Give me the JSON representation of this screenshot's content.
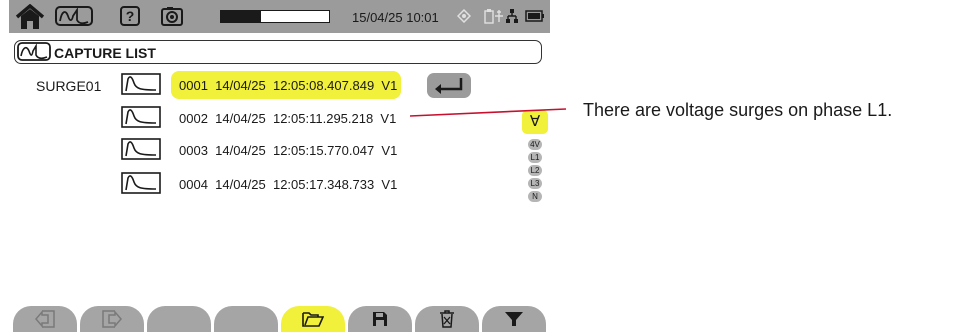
{
  "top_bar": {
    "icons": [
      "home-icon",
      "waveform-mode-icon",
      "help-icon",
      "camera-icon",
      "target-icon",
      "usb-icon",
      "network-icon",
      "battery-icon"
    ],
    "help_label": "?",
    "storage_used_fraction": 0.37,
    "datetime": "15/04/25 10:01"
  },
  "title_bar": {
    "title": "CAPTURE LIST",
    "icon": "waveform-mode-icon"
  },
  "capture_group": {
    "label": "SURGE01"
  },
  "capture_rows": [
    {
      "text": "0001  14/04/25  12:05:08.407.849  V1",
      "selected": true
    },
    {
      "text": "0002  14/04/25  12:05:11.295.218  V1",
      "selected": false
    },
    {
      "text": "0003  14/04/25  12:05:15.770.047  V1",
      "selected": false
    },
    {
      "text": "0004  14/04/25  12:05:17.348.733  V1",
      "selected": false
    }
  ],
  "filter": {
    "selected": "∀",
    "options": [
      "4V",
      "L1",
      "L2",
      "L3",
      "N"
    ]
  },
  "bottom_buttons": [
    "import-icon",
    "export-icon",
    "",
    "",
    "open-folder-icon",
    "save-icon",
    "trash-icon",
    "filter-icon"
  ],
  "colors": {
    "highlight": "#f1f03a",
    "bar_gray": "#9b9b9b",
    "callout_red": "#c8102e"
  },
  "annotation": "There are voltage surges on phase L1."
}
